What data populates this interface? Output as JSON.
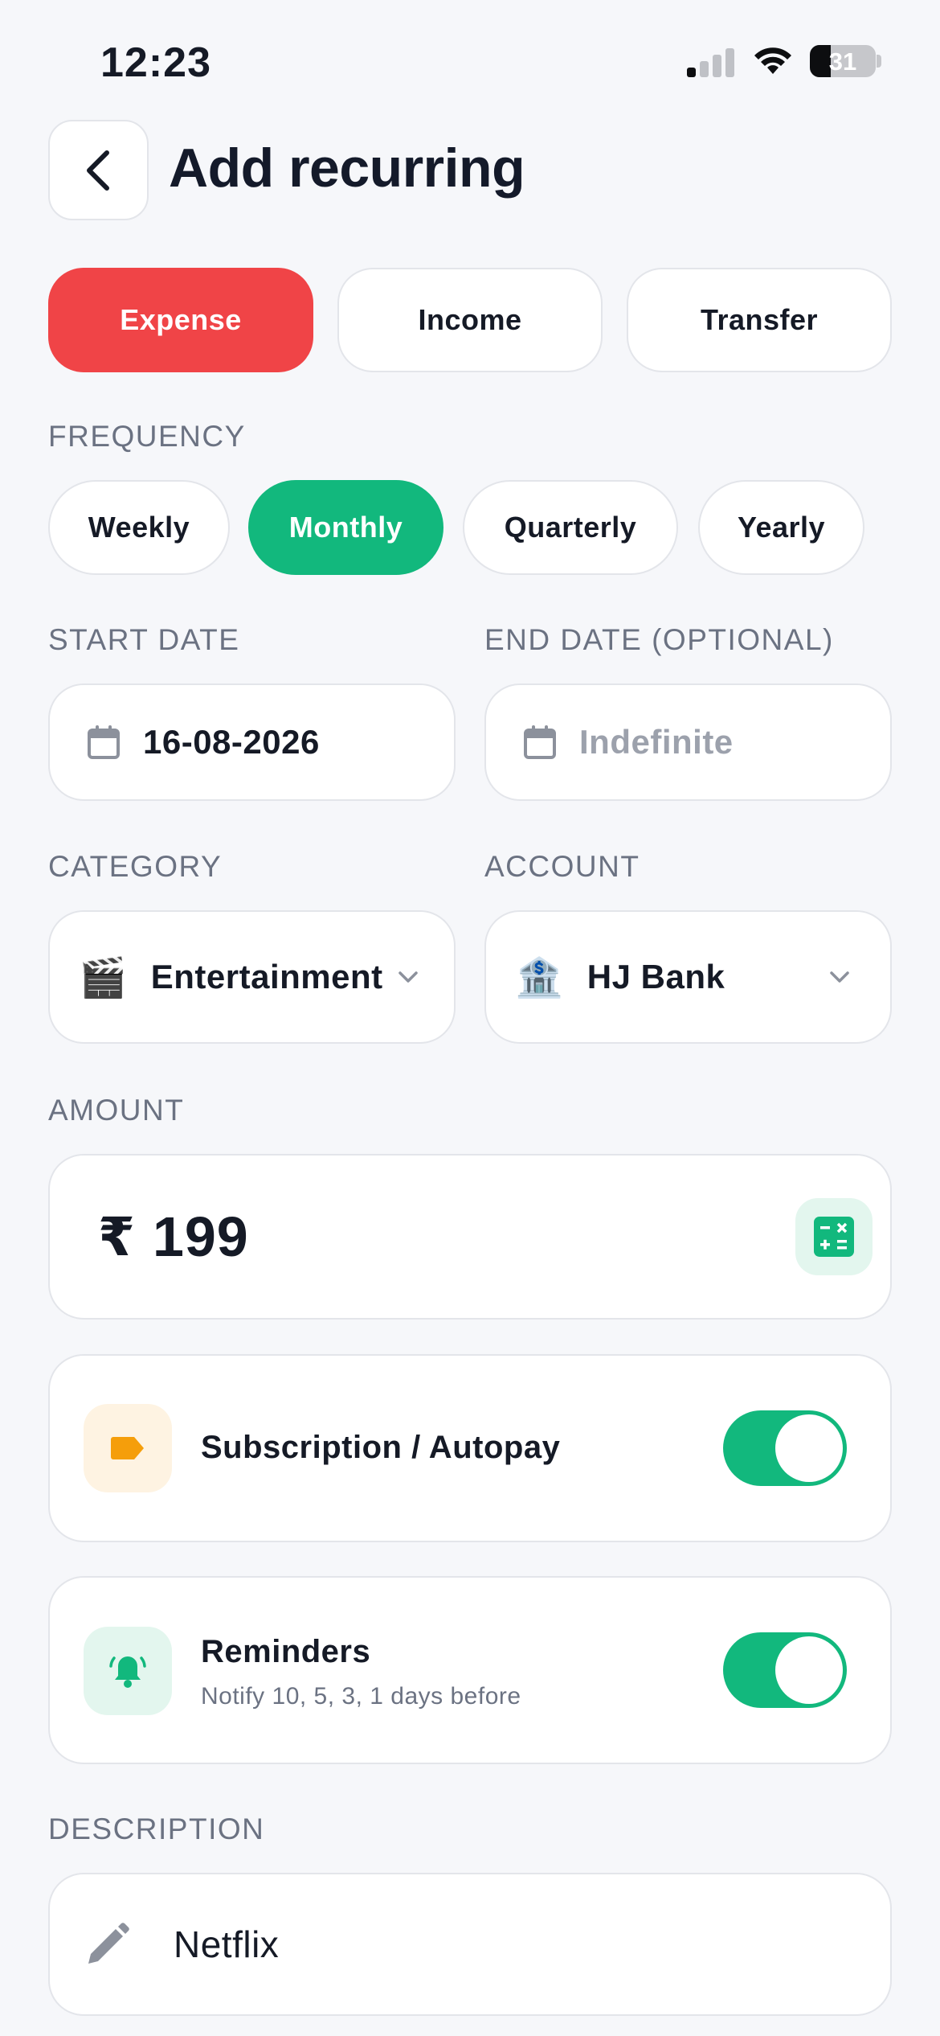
{
  "status_bar": {
    "time": "12:23",
    "battery": "31"
  },
  "header": {
    "title": "Add recurring"
  },
  "type_tabs": [
    {
      "label": "Expense",
      "active": true
    },
    {
      "label": "Income",
      "active": false
    },
    {
      "label": "Transfer",
      "active": false
    }
  ],
  "frequency": {
    "label": "FREQUENCY",
    "options": [
      {
        "label": "Weekly",
        "active": false
      },
      {
        "label": "Monthly",
        "active": true
      },
      {
        "label": "Quarterly",
        "active": false
      },
      {
        "label": "Yearly",
        "active": false
      }
    ]
  },
  "start_date": {
    "label": "START DATE",
    "value": "16-08-2026"
  },
  "end_date": {
    "label": "END DATE (OPTIONAL)",
    "placeholder": "Indefinite"
  },
  "category": {
    "label": "CATEGORY",
    "value": "Entertainment",
    "emoji": "🎬"
  },
  "account": {
    "label": "ACCOUNT",
    "value": "HJ Bank",
    "emoji": "🏦"
  },
  "amount": {
    "label": "AMOUNT",
    "currency": "₹",
    "value": "199"
  },
  "subscription": {
    "label": "Subscription / Autopay",
    "enabled": true
  },
  "reminders": {
    "label": "Reminders",
    "sub": "Notify 10, 5, 3, 1 days before",
    "enabled": true
  },
  "description": {
    "label": "DESCRIPTION",
    "value": "Netflix"
  },
  "colors": {
    "expense": "#F04447",
    "accent": "#12B87D",
    "tag": "#F59E0B"
  }
}
